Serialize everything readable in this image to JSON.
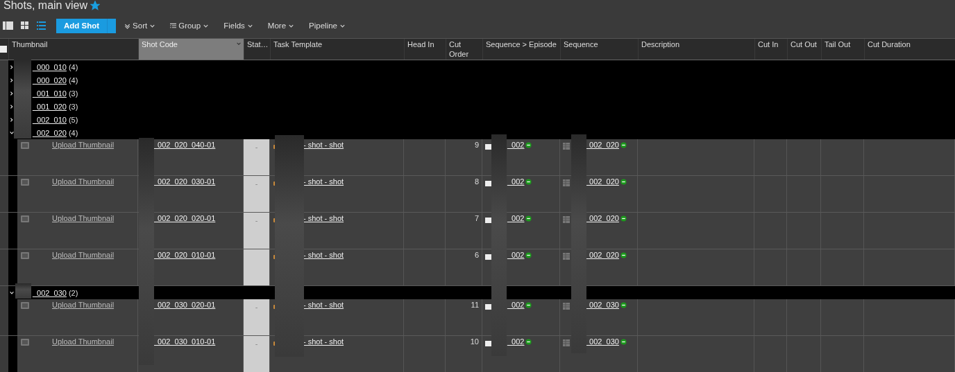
{
  "page": {
    "title": "Shots, main view",
    "favorite": true
  },
  "toolbar": {
    "views": [
      {
        "kind": "detail",
        "selected": false
      },
      {
        "kind": "grid",
        "selected": false
      },
      {
        "kind": "list",
        "selected": true
      }
    ],
    "add_button": "Add Shot",
    "menus": [
      {
        "label": "Sort",
        "kind": "sort"
      },
      {
        "label": "Group",
        "kind": "group"
      },
      {
        "label": "Fields",
        "kind": "plain"
      },
      {
        "label": "More",
        "kind": "plain"
      },
      {
        "label": "Pipeline",
        "kind": "plain"
      }
    ]
  },
  "table": {
    "select_all": {
      "checked": false
    },
    "columns": [
      {
        "label": "Thumbnail",
        "sorted": false
      },
      {
        "label": "Shot Code",
        "sorted": true
      },
      {
        "label": "Stat…",
        "sorted": false
      },
      {
        "label": "Task Template",
        "sorted": false
      },
      {
        "label": "Head In",
        "sorted": false
      },
      {
        "label": "Cut Order",
        "sorted": false
      },
      {
        "label": "Sequence > Episode",
        "sorted": false
      },
      {
        "label": "Sequence",
        "sorted": false
      },
      {
        "label": "Description",
        "sorted": false
      },
      {
        "label": "Cut In",
        "sorted": false
      },
      {
        "label": "Cut Out",
        "sorted": false
      },
      {
        "label": "Tail Out",
        "sorted": false
      },
      {
        "label": "Cut Duration",
        "sorted": false
      }
    ],
    "groups": [
      {
        "name": "_000_010",
        "count": "(4)",
        "expanded": false
      },
      {
        "name": "_000_020",
        "count": "(4)",
        "expanded": false
      },
      {
        "name": "_001_010",
        "count": "(3)",
        "expanded": false
      },
      {
        "name": "_001_020",
        "count": "(3)",
        "expanded": false
      },
      {
        "name": "_002_010",
        "count": "(5)",
        "expanded": false
      },
      {
        "name": "_002_020",
        "count": "(4)",
        "expanded": true,
        "rows": [
          {
            "thumbnail": "Upload Thumbnail",
            "shot_code": "_002_020_040-01",
            "status": "-",
            "task_template": "- shot - shot",
            "cut_order": "9",
            "episode": "_002",
            "sequence": "_002_020"
          },
          {
            "thumbnail": "Upload Thumbnail",
            "shot_code": "_002_020_030-01",
            "status": "-",
            "task_template": "- shot - shot",
            "cut_order": "8",
            "episode": "_002",
            "sequence": "_002_020"
          },
          {
            "thumbnail": "Upload Thumbnail",
            "shot_code": "_002_020_020-01",
            "status": "-",
            "task_template": "- shot - shot",
            "cut_order": "7",
            "episode": "_002",
            "sequence": "_002_020"
          },
          {
            "thumbnail": "Upload Thumbnail",
            "shot_code": "_002_020_010-01",
            "task_template": "- shot - shot",
            "cut_order": "6",
            "episode": "_002",
            "sequence": "_002_020"
          }
        ]
      },
      {
        "name": "_002_030",
        "count": "(2)",
        "expanded": true,
        "rows": [
          {
            "thumbnail": "Upload Thumbnail",
            "shot_code": "_002_030_020-01",
            "status": "-",
            "task_template": "- shot - shot",
            "cut_order": "11",
            "episode": "_002",
            "sequence": "_002_030"
          },
          {
            "thumbnail": "Upload Thumbnail",
            "shot_code": "_002_030_010-01",
            "status": "-",
            "task_template": "- shot - shot",
            "cut_order": "10",
            "episode": "_002",
            "sequence": "_002_030"
          }
        ]
      }
    ]
  }
}
